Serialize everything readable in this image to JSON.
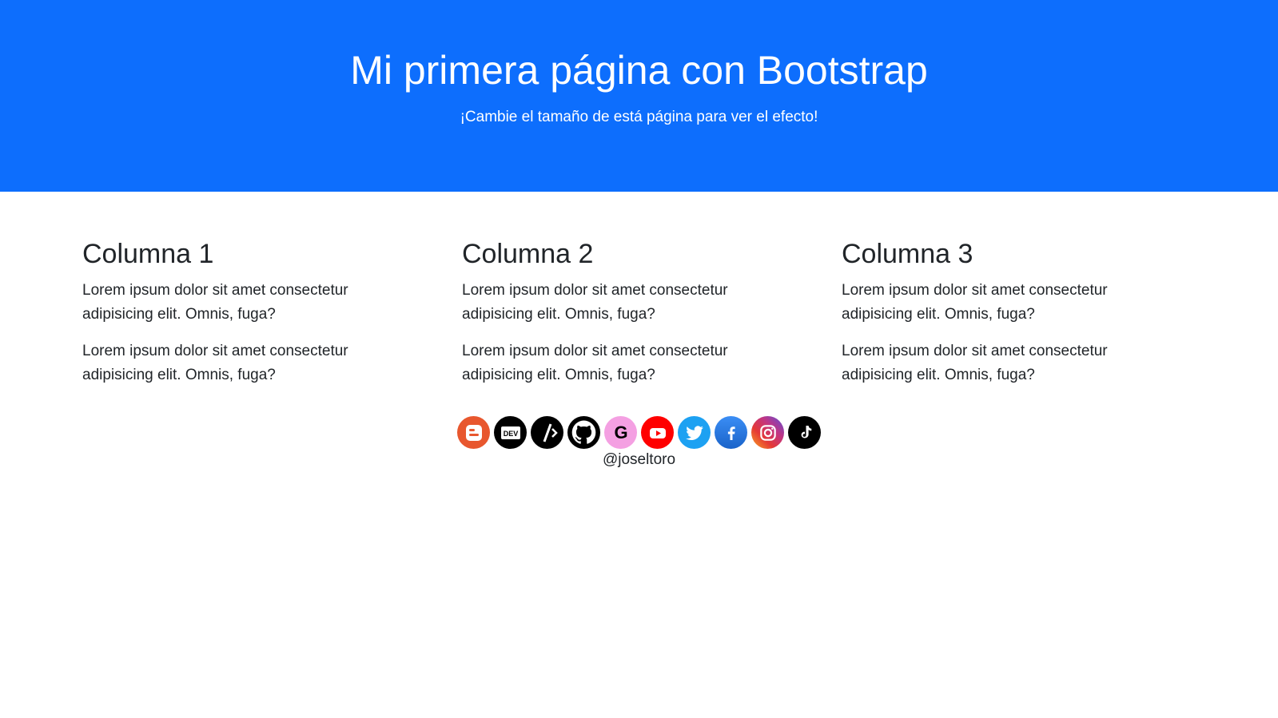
{
  "hero": {
    "title": "Mi primera página con Bootstrap",
    "subtitle": "¡Cambie el tamaño de está página para ver el efecto!",
    "background": "#0d6efd"
  },
  "columns": [
    {
      "heading": "Columna 1",
      "paragraphs": [
        "Lorem ipsum dolor sit amet consectetur adipisicing elit. Omnis, fuga?",
        "Lorem ipsum dolor sit amet consectetur adipisicing elit. Omnis, fuga?"
      ]
    },
    {
      "heading": "Columna 2",
      "paragraphs": [
        "Lorem ipsum dolor sit amet consectetur adipisicing elit. Omnis, fuga?",
        "Lorem ipsum dolor sit amet consectetur adipisicing elit. Omnis, fuga?"
      ]
    },
    {
      "heading": "Columna 3",
      "paragraphs": [
        "Lorem ipsum dolor sit amet consectetur adipisicing elit. Omnis, fuga?",
        "Lorem ipsum dolor sit amet consectetur adipisicing elit. Omnis, fuga?"
      ]
    }
  ],
  "social": {
    "icons": [
      {
        "name": "blogger-icon",
        "color": "#e8572e"
      },
      {
        "name": "dev-icon",
        "color": "#000000"
      },
      {
        "name": "codepen-slash-icon",
        "color": "#000000"
      },
      {
        "name": "github-icon",
        "color": "#000000"
      },
      {
        "name": "google-icon",
        "color": "#f4a0e2"
      },
      {
        "name": "youtube-icon",
        "color": "#ff0000"
      },
      {
        "name": "twitter-icon",
        "color": "#1da1f2"
      },
      {
        "name": "facebook-icon",
        "color": "#1877f2"
      },
      {
        "name": "instagram-icon",
        "color": "#c13584"
      },
      {
        "name": "tiktok-icon",
        "color": "#000000"
      }
    ],
    "dev_label": "DEV",
    "google_label": "G",
    "handle": "@joseltoro"
  }
}
